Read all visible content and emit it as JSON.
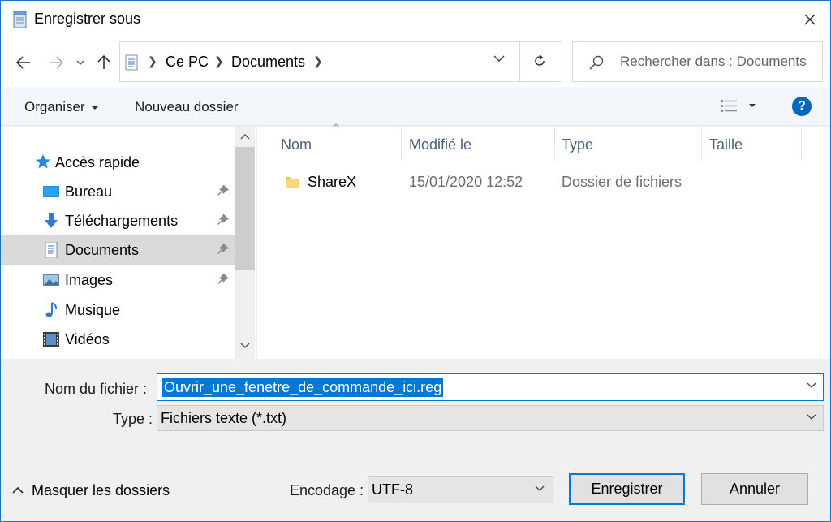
{
  "window": {
    "title": "Enregistrer sous",
    "close_label": "×"
  },
  "address": {
    "crumbs": [
      "Ce PC",
      "Documents"
    ],
    "search_placeholder": "Rechercher dans : Documents"
  },
  "commands": {
    "organize": "Organiser",
    "new_folder": "Nouveau dossier",
    "help": "?"
  },
  "nav": {
    "quick_access": "Accès rapide",
    "items": [
      {
        "label": "Bureau",
        "pinned": true
      },
      {
        "label": "Téléchargements",
        "pinned": true
      },
      {
        "label": "Documents",
        "pinned": true,
        "selected": true
      },
      {
        "label": "Images",
        "pinned": true
      },
      {
        "label": "Musique",
        "pinned": false
      },
      {
        "label": "Vidéos",
        "pinned": false
      }
    ]
  },
  "columns": {
    "name": "Nom",
    "modified": "Modifié le",
    "type": "Type",
    "size": "Taille"
  },
  "files": [
    {
      "name": "ShareX",
      "modified": "15/01/2020 12:52",
      "type": "Dossier de fichiers",
      "size": ""
    }
  ],
  "form": {
    "filename_label": "Nom du fichier :",
    "filename_value": "Ouvrir_une_fenetre_de_commande_ici.reg",
    "type_label": "Type :",
    "type_value": "Fichiers texte (*.txt)",
    "encoding_label": "Encodage :",
    "encoding_value": "UTF-8",
    "hide_folders": "Masquer les dossiers",
    "save_button": "Enregistrer",
    "cancel_button": "Annuler"
  },
  "colors": {
    "accent": "#0078d7",
    "selection": "#d9d9d9",
    "column_header": "#4c607a"
  }
}
